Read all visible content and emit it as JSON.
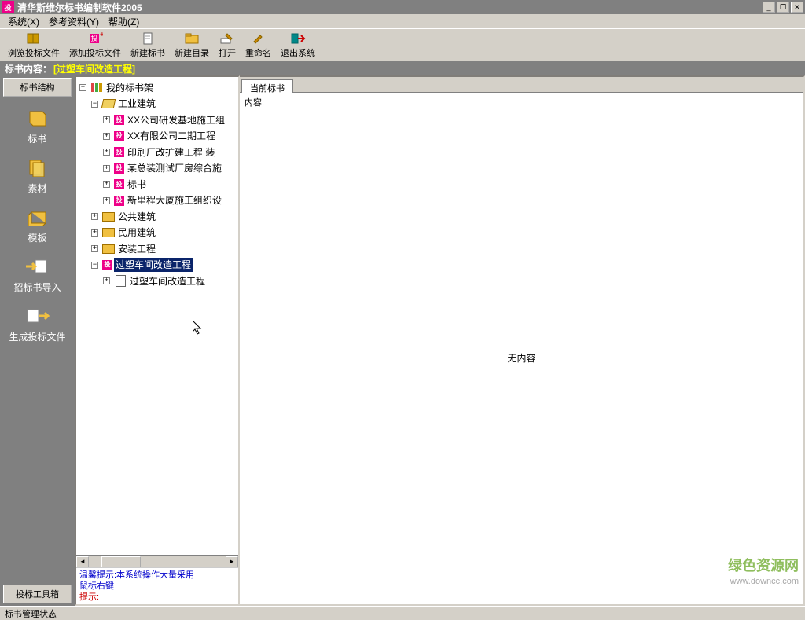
{
  "window": {
    "icon_text": "投",
    "title": "清华斯维尔标书编制软件2005"
  },
  "menus": [
    {
      "label": "系统(X)"
    },
    {
      "label": "参考资料(Y)"
    },
    {
      "label": "帮助(Z)"
    }
  ],
  "toolbar": [
    {
      "name": "browse-bid-file",
      "label": "浏览投标文件",
      "icon": "book"
    },
    {
      "name": "add-bid-file",
      "label": "添加投标文件",
      "icon": "bid-add"
    },
    {
      "name": "new-bid",
      "label": "新建标书",
      "icon": "doc"
    },
    {
      "name": "new-dir",
      "label": "新建目录",
      "icon": "folder"
    },
    {
      "name": "open",
      "label": "打开",
      "icon": "open"
    },
    {
      "name": "rename",
      "label": "重命名",
      "icon": "pen"
    },
    {
      "name": "exit",
      "label": "退出系统",
      "icon": "exit"
    }
  ],
  "header": {
    "prefix": "标书内容：",
    "project": "[过塑车间改造工程]"
  },
  "sidebar": {
    "top_tab": "标书结构",
    "items": [
      {
        "name": "bid",
        "label": "标书"
      },
      {
        "name": "material",
        "label": "素材"
      },
      {
        "name": "template",
        "label": "模板"
      },
      {
        "name": "tender-import",
        "label": "招标书导入"
      },
      {
        "name": "generate-bid-file",
        "label": "生成投标文件"
      }
    ],
    "bottom_tab": "投标工具箱"
  },
  "tree": {
    "root": {
      "label": "我的标书架",
      "expanded": true
    },
    "industrial": {
      "label": "工业建筑",
      "expanded": true,
      "children": [
        {
          "label": "XX公司研发基地施工组"
        },
        {
          "label": "XX有限公司二期工程"
        },
        {
          "label": "印刷厂改扩建工程 装"
        },
        {
          "label": "某总装测试厂房综合施"
        },
        {
          "label": "标书"
        },
        {
          "label": "新里程大厦施工组织设"
        }
      ]
    },
    "public": {
      "label": "公共建筑"
    },
    "civil": {
      "label": "民用建筑"
    },
    "install": {
      "label": "安装工程"
    },
    "selected": {
      "label": "过塑车间改造工程",
      "expanded": true,
      "child": {
        "label": "过塑车间改造工程"
      }
    }
  },
  "hints": {
    "line1": "温馨提示:本系统操作大量采用",
    "line2": "鼠标右键",
    "line3": "提示:"
  },
  "content": {
    "tab": "当前标书",
    "label": "内容:",
    "empty": "无内容"
  },
  "status": "标书管理状态",
  "watermark": {
    "text": "绿色资源网",
    "url": "www.downcc.com"
  }
}
